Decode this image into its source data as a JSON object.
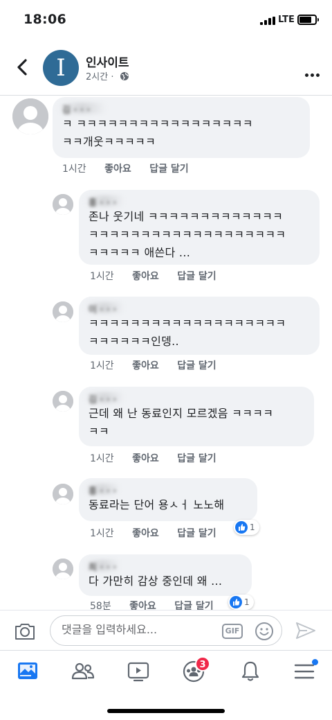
{
  "status_bar": {
    "time": "18:06",
    "network": "LTE"
  },
  "header": {
    "page_logo_letter": "I",
    "page_name": "인사이트",
    "post_time": "2시간 ·"
  },
  "comments": [
    {
      "author": "김 · · ·",
      "text": "ㅋ ㅋㅋㅋㅋㅋㅋㅋㅋㅋㅋㅋㅋㅋㅋㅋㅋㅋ\nㅋㅋ개웃ㅋㅋㅋㅋㅋ",
      "time": "1시간",
      "like": "좋아요",
      "reply": "답글 달기"
    },
    {
      "author": "홍 · · ·",
      "text": "존나 웃기네 ㅋㅋㅋㅋㅋㅋㅋㅋㅋㅋㅋㅋㅋ\nㅋㅋㅋㅋㅋㅋㅋㅋㅋㅋㅋㅋㅋㅋㅋㅋㅋㅋㅋ\nㅋㅋㅋㅋㅋ 애쓴다 ...",
      "time": "1시간",
      "like": "좋아요",
      "reply": "답글 달기"
    },
    {
      "author": "이 · · ·",
      "text": "ㅋㅋㅋㅋㅋㅋㅋㅋㅋㅋㅋㅋㅋㅋㅋㅋㅋㅋㅋ\nㅋㅋㅋㅋㅋㅋ인뎅..",
      "time": "1시간",
      "like": "좋아요",
      "reply": "답글 달기"
    },
    {
      "author": "김 · · ·",
      "text": "근데 왜 난 동료인지 모르겠음 ㅋㅋㅋㅋ\nㅋㅋ",
      "time": "1시간",
      "like": "좋아요",
      "reply": "답글 달기"
    },
    {
      "author": "홍 · · ·",
      "text": "동료라는 단어 용ㅅㅓ 노노해",
      "time": "1시간",
      "like": "좋아요",
      "reply": "답글 달기",
      "reactions": "1"
    },
    {
      "author": "최 · · ·",
      "text": "다 가만히 감상 중인데 왜 ...",
      "time": "58분",
      "like": "좋아요",
      "reply": "답글 달기",
      "reactions": "1"
    }
  ],
  "input": {
    "placeholder": "댓글을 입력하세요...",
    "gif_label": "GIF"
  },
  "tabbar": {
    "tabs": [
      "news-feed",
      "friends",
      "watch",
      "groups",
      "notifications",
      "menu"
    ],
    "groups_badge": "3"
  },
  "colors": {
    "brand_blue": "#1877f2",
    "page_logo_bg": "#2f6b96",
    "bubble_bg": "#f0f2f5",
    "badge_red": "#f02849"
  }
}
